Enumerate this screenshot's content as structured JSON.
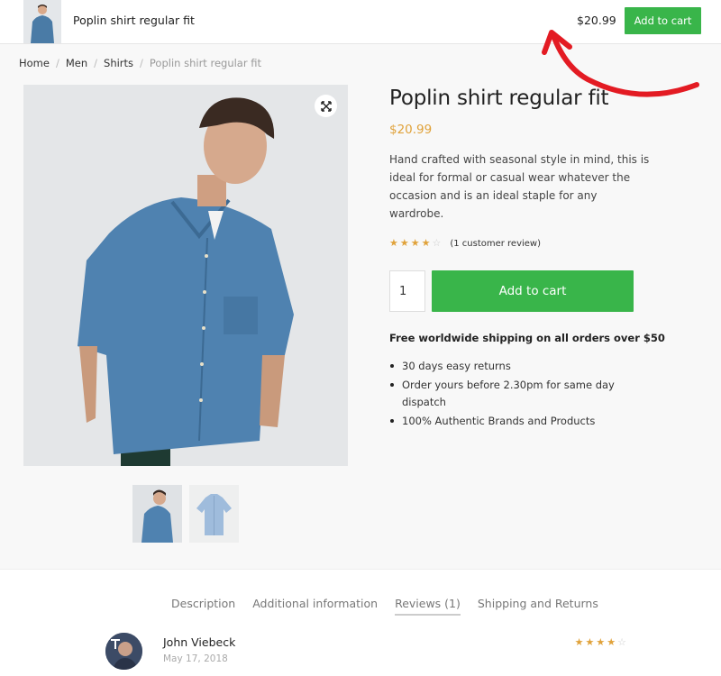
{
  "sticky_bar": {
    "title": "Poplin shirt regular fit",
    "price": "$20.99",
    "cart_label": "Add to cart"
  },
  "breadcrumb": {
    "items": [
      "Home",
      "Men",
      "Shirts"
    ],
    "current": "Poplin shirt regular fit"
  },
  "gallery": {
    "zoom_icon": "expand-icon",
    "thumbnails": [
      "model-wearing-shirt",
      "shirt-flat"
    ]
  },
  "product": {
    "title": "Poplin shirt regular fit",
    "price": "$20.99",
    "description": "Hand crafted with seasonal style in mind, this is ideal for formal or casual wear whatever the occasion and is an ideal staple for any wardrobe.",
    "rating": {
      "value": 4,
      "max": 5,
      "review_link": "(1 customer review)"
    },
    "quantity": "1",
    "cart_label": "Add to cart",
    "shipping_title": "Free worldwide shipping on all orders over $50",
    "bullets": [
      "30 days easy returns",
      "Order yours before 2.30pm for same day dispatch",
      "100% Authentic Brands and Products"
    ]
  },
  "tabs": [
    {
      "label": "Description",
      "active": false
    },
    {
      "label": "Additional information",
      "active": false
    },
    {
      "label": "Reviews (1)",
      "active": true
    },
    {
      "label": "Shipping and Returns",
      "active": false
    }
  ],
  "review": {
    "author": "John Viebeck",
    "date": "May 17, 2018",
    "rating": 4
  },
  "colors": {
    "accent_green": "#39b54a",
    "price_orange": "#e0a23a",
    "annotation_red": "#e31b23"
  }
}
